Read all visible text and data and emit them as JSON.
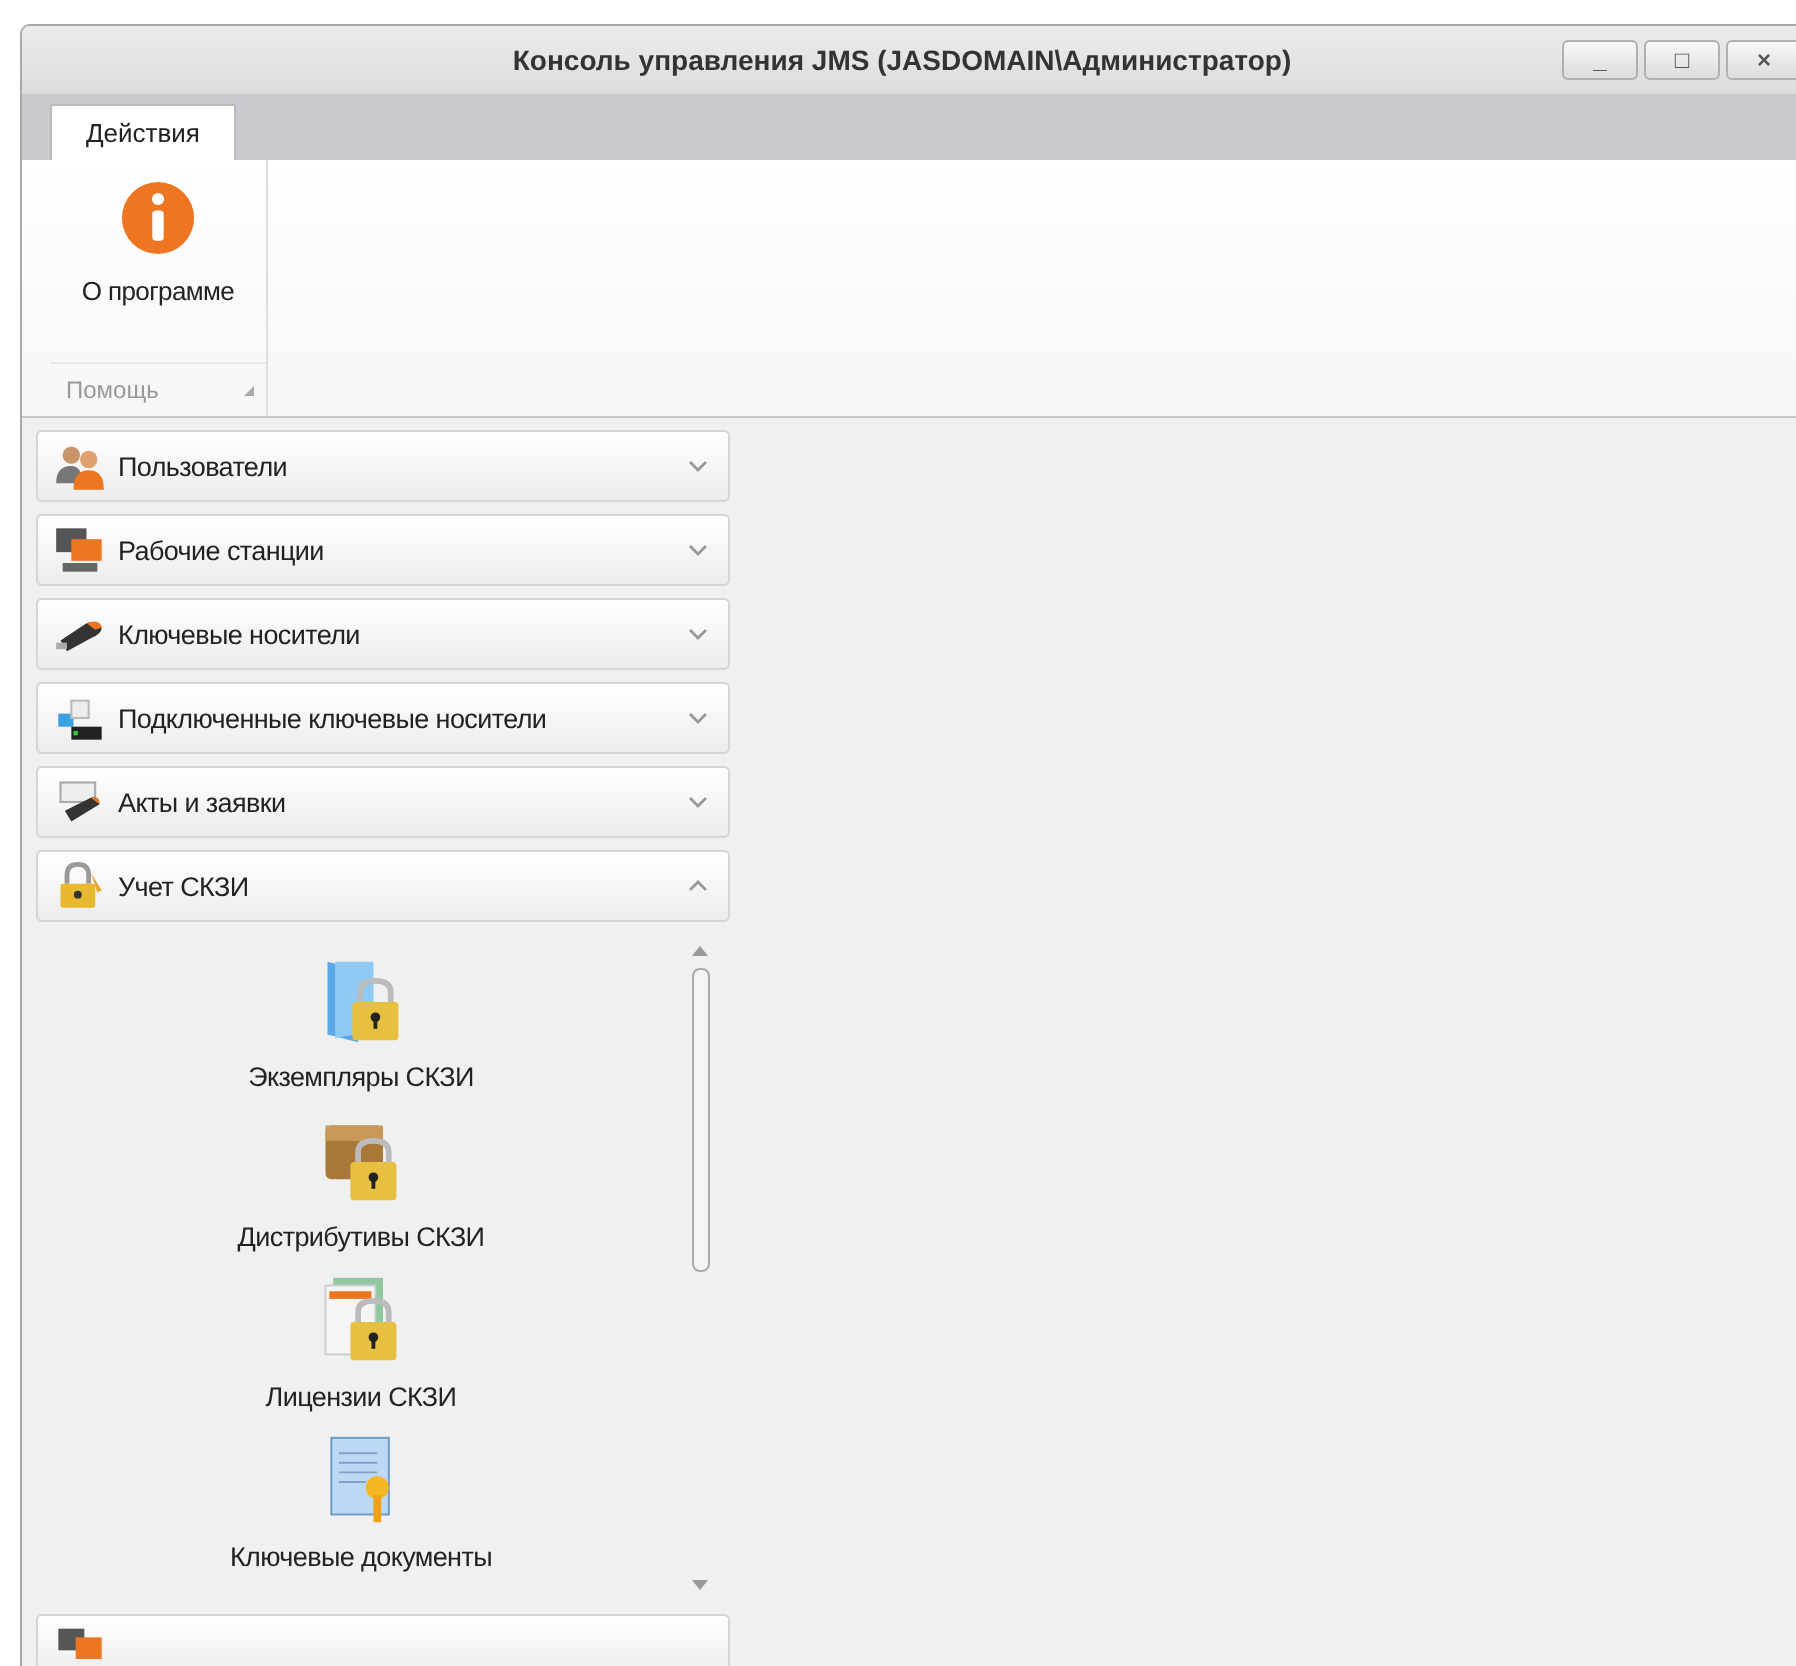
{
  "window": {
    "title": "Консоль управления JMS (JASDOMAIN\\Администратор)",
    "controls": [
      "_",
      "□",
      "×"
    ]
  },
  "ribbon": {
    "tabs": [
      {
        "label": "Действия",
        "selected": true
      }
    ],
    "groups": [
      {
        "label": "Помощь",
        "buttons": [
          {
            "label": "О программе"
          }
        ]
      }
    ]
  },
  "navigation": {
    "groups": [
      {
        "label": "Пользователи",
        "expanded": false
      },
      {
        "label": "Рабочие станции",
        "expanded": false
      },
      {
        "label": "Ключевые носители",
        "expanded": false
      },
      {
        "label": "Подключенные ключевые носители",
        "expanded": false
      },
      {
        "label": "Акты и заявки",
        "expanded": false
      },
      {
        "label": "Учет СКЗИ",
        "expanded": true,
        "items": [
          {
            "label": "Экземпляры СКЗИ"
          },
          {
            "label": "Дистрибутивы СКЗИ"
          },
          {
            "label": "Лицензии СКЗИ"
          },
          {
            "label": "Ключевые документы"
          }
        ]
      }
    ]
  }
}
